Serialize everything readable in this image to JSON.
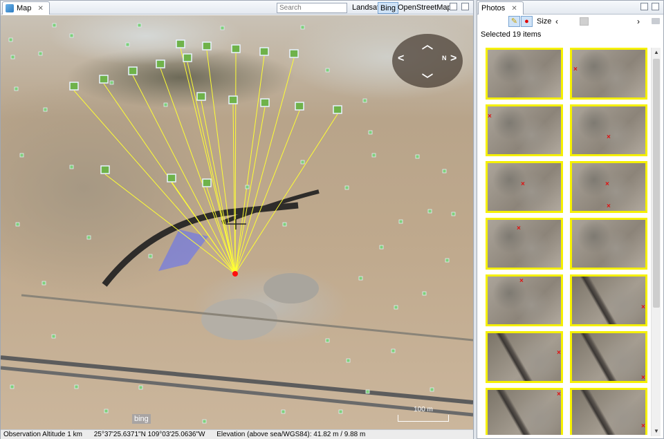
{
  "map": {
    "tab_label": "Map",
    "search_placeholder": "Search",
    "layers": [
      "Landsat",
      "Bing",
      "OpenStreetMap"
    ],
    "active_layer": "Bing",
    "bing_logo": "bing",
    "scale_label": "100 m",
    "status": {
      "altitude": "Observation Altitude 1 km",
      "coords": "25°37'25.6371\"N 109°03'25.0636\"W",
      "elevation": "Elevation (above sea/WGS84): 41.82 m / 9.88 m"
    },
    "icons": {
      "tab": "map-icon",
      "photo_marker": "photo-icon",
      "nav_up": "chevron-up-icon",
      "nav_down": "chevron-down-icon",
      "nav_left": "chevron-left-icon",
      "nav_right": "chevron-right-icon",
      "nav_north": "compass-icon"
    },
    "colors": {
      "connector": "#ffff33",
      "camera_point": "#ff1010",
      "coverage": "#5a6cff"
    }
  },
  "photos": {
    "tab_label": "Photos",
    "size_label": "Size",
    "selected_text": "Selected 19 items",
    "icons": {
      "pen": "pen-icon",
      "record": "record-icon",
      "folder": "folder-icon"
    },
    "thumbnail_border_color": "#f5f000",
    "marker_color": "#e01010"
  }
}
